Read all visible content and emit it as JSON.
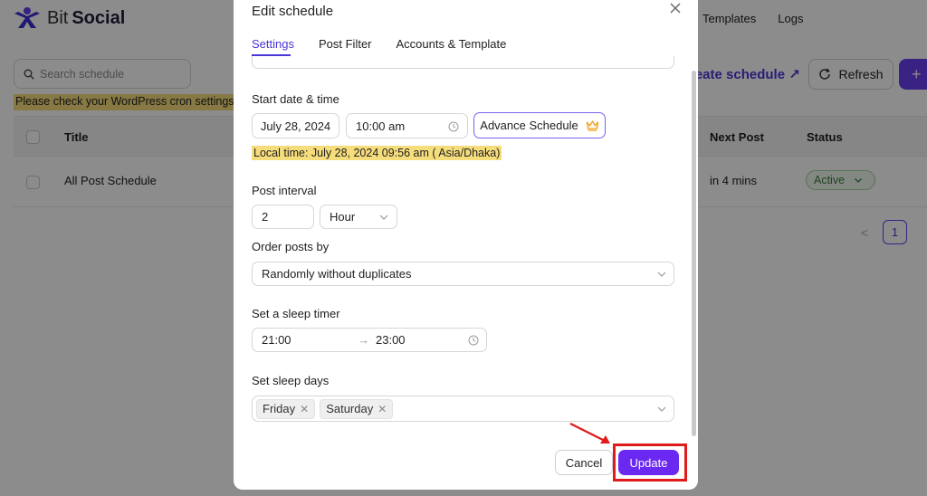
{
  "app": {
    "brand_word1": "Bit",
    "brand_word2": "Social",
    "nav_items": [
      "Templates",
      "Logs"
    ],
    "search_placeholder": "Search schedule",
    "create_link": "reate schedule ↗",
    "refresh_label": "Refresh",
    "add_label": "+",
    "warning": "Please check your WordPress cron settings. If y",
    "table": {
      "headers": {
        "title": "Title",
        "next_post": "Next Post",
        "status": "Status"
      },
      "rows": [
        {
          "title": "All Post Schedule",
          "next_post": "in 4 mins",
          "status": "Active"
        }
      ]
    },
    "pagination": {
      "prev": "<",
      "current_page": "1"
    }
  },
  "modal": {
    "title": "Edit schedule",
    "tabs": [
      "Settings",
      "Post Filter",
      "Accounts & Template"
    ],
    "active_tab": "Settings",
    "start": {
      "label": "Start date & time",
      "date": "July 28, 2024",
      "time": "10:00 am",
      "advance_label": "Advance Schedule",
      "local_time": "Local time: July 28, 2024 09:56 am ( Asia/Dhaka)"
    },
    "interval": {
      "label": "Post interval",
      "value": "2",
      "unit": "Hour"
    },
    "order": {
      "label": "Order posts by",
      "value": "Randomly without duplicates"
    },
    "sleep_timer": {
      "label": "Set a sleep timer",
      "from": "21:00",
      "arrow": "→",
      "to": "23:00"
    },
    "sleep_days": {
      "label": "Set sleep days",
      "tags": [
        "Friday",
        "Saturday"
      ]
    },
    "buttons": {
      "cancel": "Cancel",
      "update": "Update"
    },
    "colors": {
      "accent": "#6a28f0",
      "annotation": "#e01b1b",
      "highlight": "#f6dd7c"
    }
  }
}
